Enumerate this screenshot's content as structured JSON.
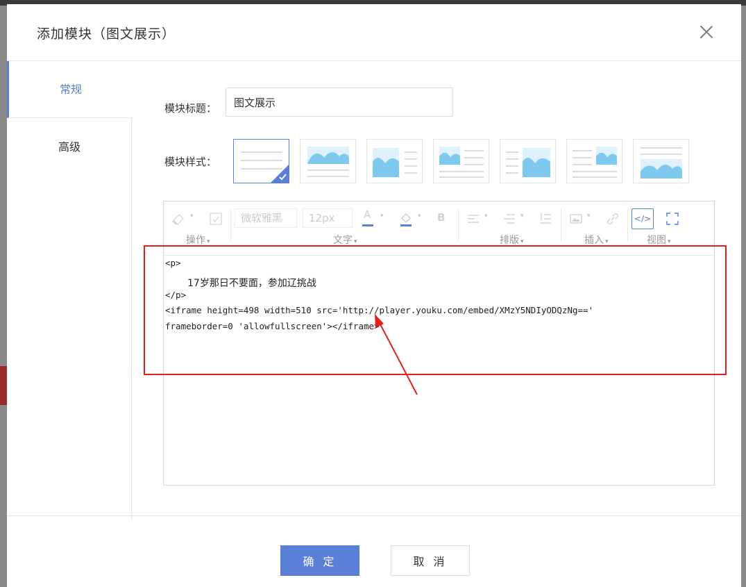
{
  "dialog": {
    "title": "添加模块（图文展示）"
  },
  "sidebar": {
    "items": [
      {
        "label": "常规",
        "active": true
      },
      {
        "label": "高级",
        "active": false
      }
    ]
  },
  "form": {
    "title_label": "模块标题：",
    "title_value": "图文展示",
    "style_label": "模块样式：",
    "style_options": [
      "text-only",
      "image-top",
      "image-left",
      "image-left-text",
      "image-right",
      "text-image-right",
      "image-bottom"
    ],
    "selected_style": "text-only"
  },
  "toolbar": {
    "font_name": "微软雅黑",
    "font_size": "12px",
    "groups": {
      "operate": "操作",
      "text": "文字",
      "layout": "排版",
      "insert": "插入",
      "view": "视图"
    },
    "code_view_label": "</>",
    "bold_label": "B",
    "color_label": "A"
  },
  "editor": {
    "lines": [
      "<p>",
      "</p>",
      "<iframe height=498 width=510 src='http://player.youku.com/embed/XMzY5NDIyODQzNg=='",
      "frameborder=0 'allowfullscreen'></iframe>"
    ],
    "paragraph_text": "17岁那日不要面，参加辽挑战"
  },
  "footer": {
    "ok_label": "确 定",
    "cancel_label": "取 消"
  },
  "colors": {
    "accent": "#5a7fd6",
    "annotation": "#e02020"
  }
}
